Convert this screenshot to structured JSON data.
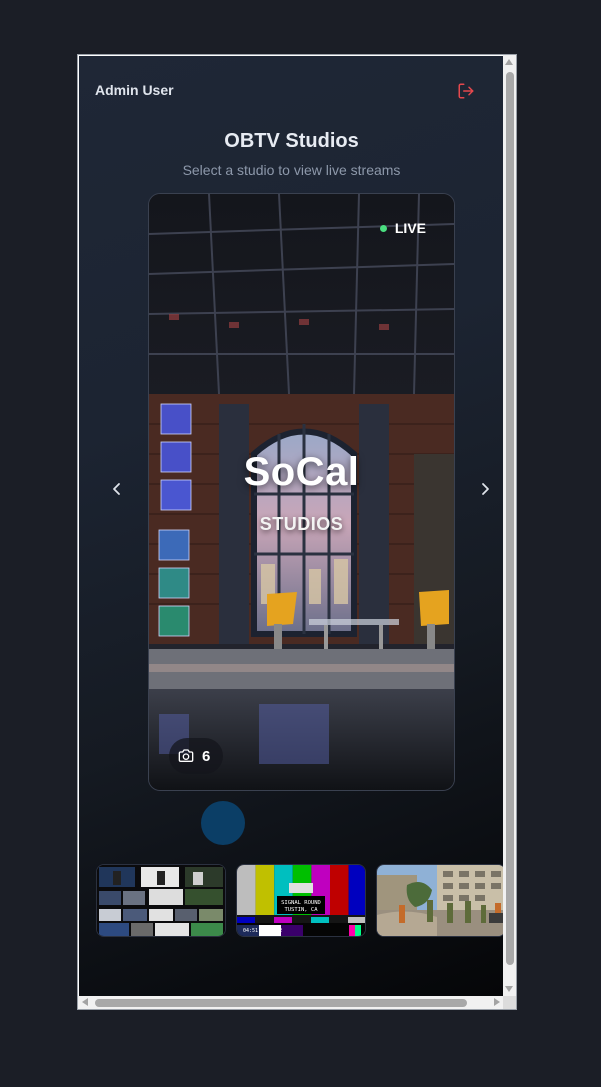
{
  "user": {
    "name": "Admin User"
  },
  "header": {
    "title": "OBTV Studios",
    "subtitle": "Select a studio to view live streams"
  },
  "studio": {
    "name": "SoCal",
    "subtitle": "STUDIOS",
    "status": "LIVE",
    "camera_count": "6",
    "status_color": "#4ade80"
  },
  "carousel": {
    "prev_icon": "chevron-left-icon",
    "next_icon": "chevron-right-icon",
    "indicator_color": "#0b3e66"
  },
  "thumbnails": [
    {
      "name": "multiview-thumbnail"
    },
    {
      "name": "color-bars-thumbnail",
      "overlay_line1": "SIGNAL ROUND",
      "overlay_line2": "TUSTIN, CA",
      "timecode": "04:51:32:32:2"
    },
    {
      "name": "street-scene-thumbnail"
    }
  ],
  "icons": {
    "logout": "logout-icon",
    "camera": "camera-icon"
  },
  "colors": {
    "background": "#1b1e26",
    "logout": "#e5484d",
    "accent_indicator": "#0b3e66"
  }
}
